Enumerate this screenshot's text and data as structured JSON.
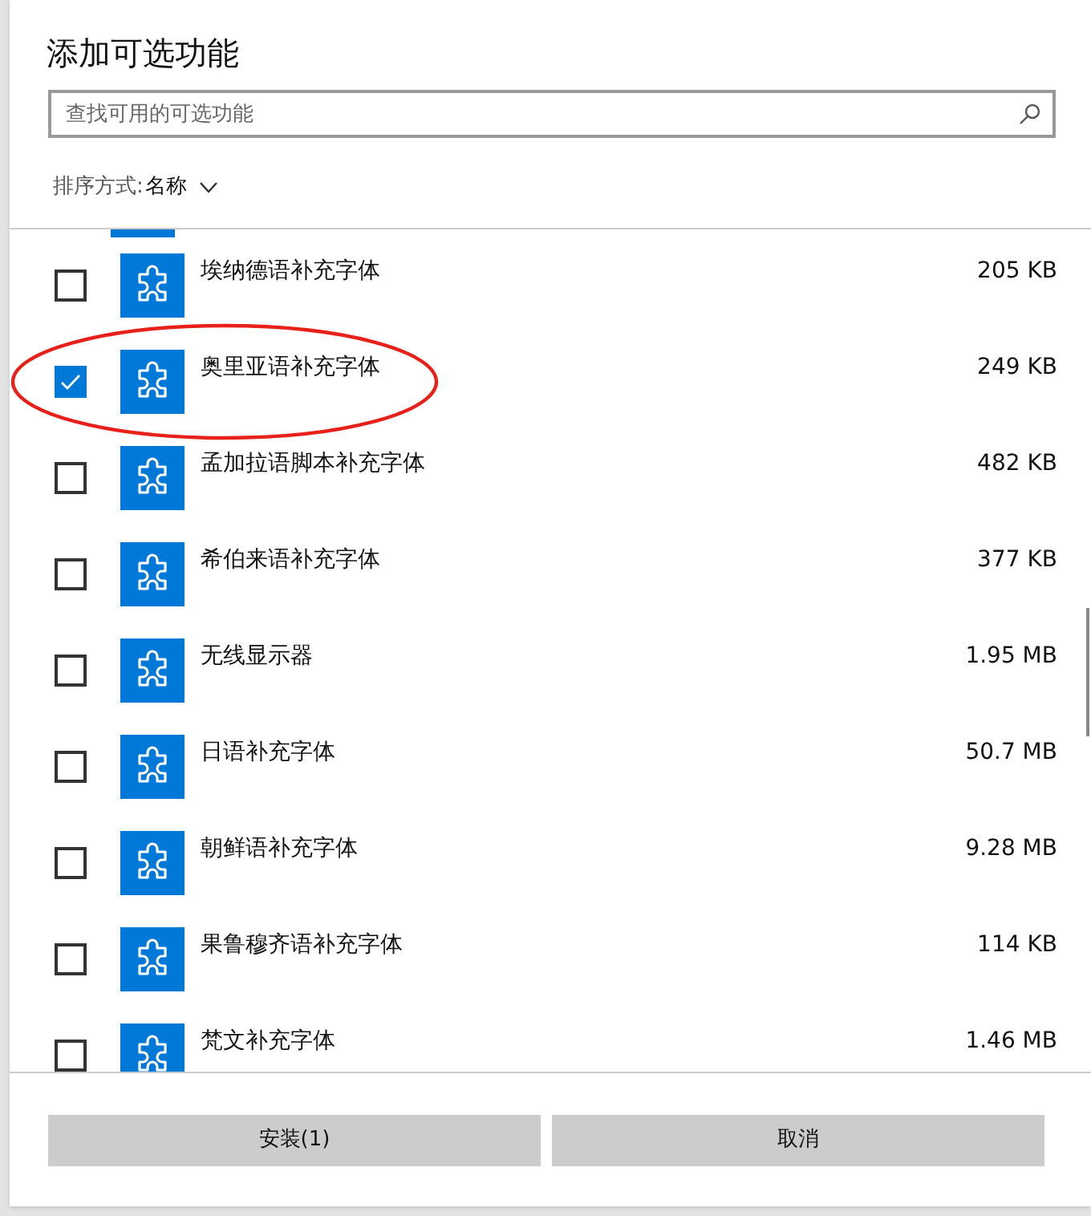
{
  "title": "添加可选功能",
  "search": {
    "placeholder": "查找可用的可选功能"
  },
  "sort": {
    "label": "排序方式:",
    "value": "名称"
  },
  "features": [
    {
      "name": "埃纳德语补充字体",
      "size": "205 KB",
      "checked": false,
      "circled": false
    },
    {
      "name": "奥里亚语补充字体",
      "size": "249 KB",
      "checked": true,
      "circled": true
    },
    {
      "name": "孟加拉语脚本补充字体",
      "size": "482 KB",
      "checked": false,
      "circled": false
    },
    {
      "name": "希伯来语补充字体",
      "size": "377 KB",
      "checked": false,
      "circled": false
    },
    {
      "name": "无线显示器",
      "size": "1.95 MB",
      "checked": false,
      "circled": false
    },
    {
      "name": "日语补充字体",
      "size": "50.7 MB",
      "checked": false,
      "circled": false
    },
    {
      "name": "朝鲜语补充字体",
      "size": "9.28 MB",
      "checked": false,
      "circled": false
    },
    {
      "name": "果鲁穆齐语补充字体",
      "size": "114 KB",
      "checked": false,
      "circled": false
    },
    {
      "name": "梵文补充字体",
      "size": "1.46 MB",
      "checked": false,
      "circled": false
    }
  ],
  "buttons": [
    "安装(1)",
    "取消"
  ]
}
